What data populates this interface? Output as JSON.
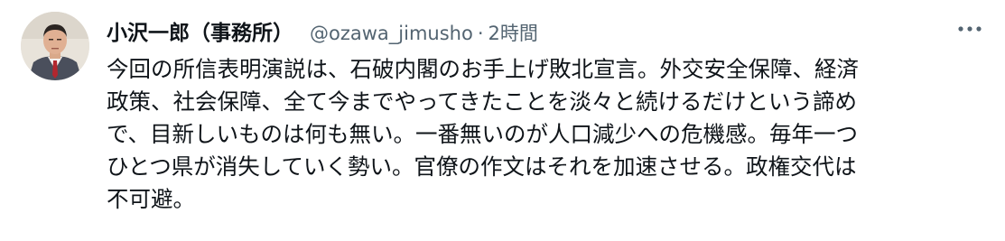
{
  "tweet": {
    "display_name": "小沢一郎（事務所）",
    "handle": "@ozawa_jimusho",
    "separator": "·",
    "time": "2時間",
    "text": "今回の所信表明演説は、石破内閣のお手上げ敗北宣言。外交安全保障、経済\n政策、社会保障、全て今までやってきたことを淡々と続けるだけという諦め\nで、目新しいものは何も無い。一番無いのが人口減少への危機感。毎年一つ\nひとつ県が消失していく勢い。官僚の作文はそれを加速させる。政権交代は\n不可避。"
  },
  "icons": {
    "more": "more-horizontal-icon"
  },
  "colors": {
    "text": "#0f1419",
    "secondary": "#536471",
    "background": "#ffffff"
  }
}
